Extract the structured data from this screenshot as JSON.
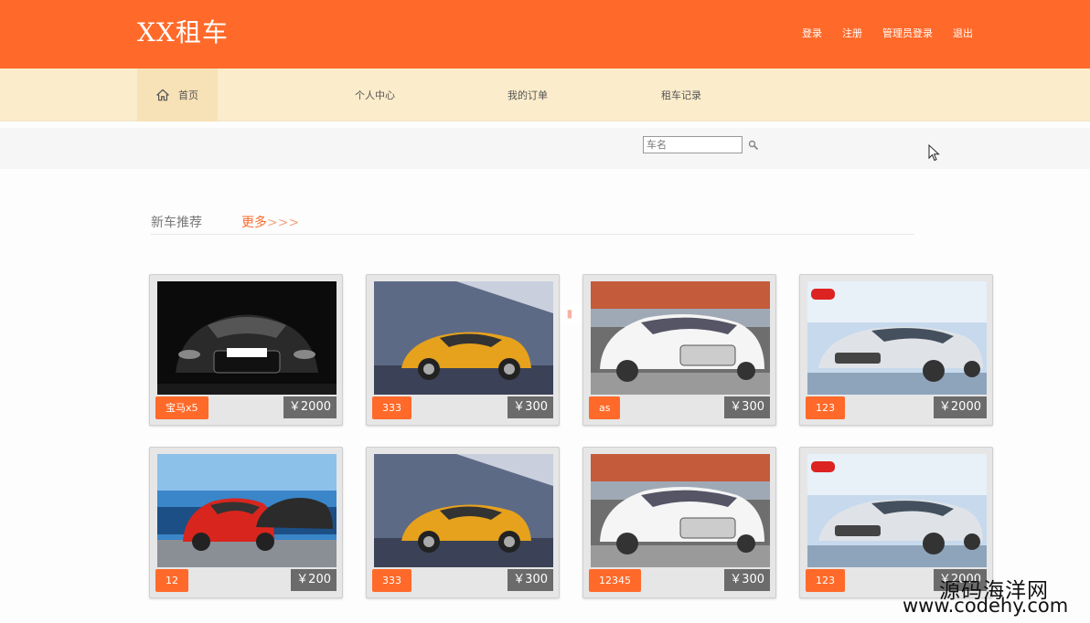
{
  "header": {
    "brand": "XX租车",
    "links": [
      "登录",
      "注册",
      "管理员登录",
      "退出"
    ]
  },
  "nav": {
    "items": [
      "首页",
      "个人中心",
      "我的订单",
      "租车记录"
    ]
  },
  "search": {
    "placeholder": "车名"
  },
  "section": {
    "title": "新车推荐",
    "more": "更多",
    "more_arrows": ">>>"
  },
  "cars": [
    {
      "name": "宝马x5",
      "price": "￥2000",
      "icon": "black-audi-tt-photo"
    },
    {
      "name": "333",
      "price": "￥300",
      "icon": "orange-audi-tt-photo"
    },
    {
      "name": "as",
      "price": "￥300",
      "icon": "white-audi-a8-photo"
    },
    {
      "name": "123",
      "price": "￥2000",
      "icon": "silver-kia-k5-photo"
    },
    {
      "name": "12",
      "price": "￥200",
      "icon": "red-bmw-3-photo"
    },
    {
      "name": "333",
      "price": "￥300",
      "icon": "orange-audi-tt-photo"
    },
    {
      "name": "12345",
      "price": "￥300",
      "icon": "white-audi-a8-photo"
    },
    {
      "name": "123",
      "price": "￥2000",
      "icon": "silver-kia-k5-photo"
    }
  ],
  "watermark": {
    "cn": "源码海洋网",
    "url": "www.codehy.com"
  },
  "colors": {
    "accent": "#ff6a2a",
    "nav_bg": "#fbeccb",
    "price_bg": "#6b6b6b"
  }
}
